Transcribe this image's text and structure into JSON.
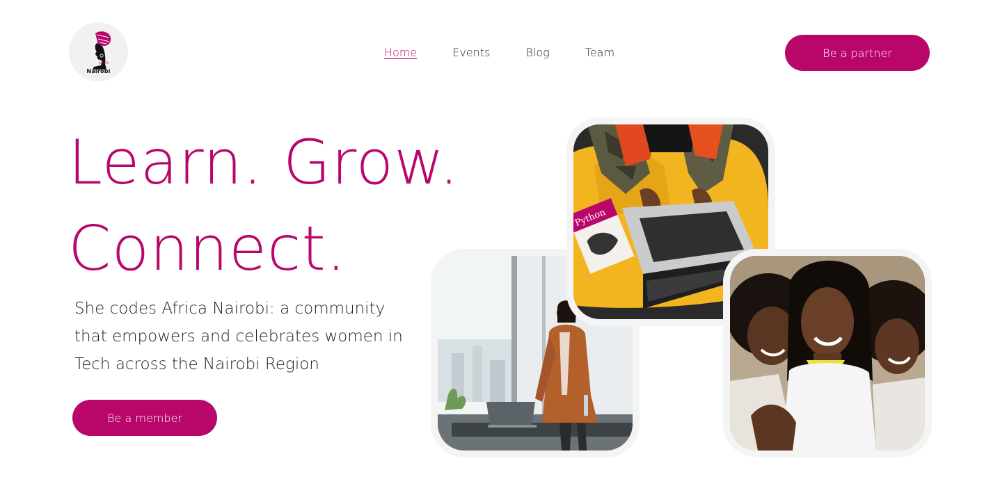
{
  "logo": {
    "text": "Nairobi",
    "icon": "she-codes-africa-logo"
  },
  "nav": {
    "items": [
      {
        "label": "Home",
        "active": true
      },
      {
        "label": "Events",
        "active": false
      },
      {
        "label": "Blog",
        "active": false
      },
      {
        "label": "Team",
        "active": false
      }
    ]
  },
  "header": {
    "partner_label": "Be a partner"
  },
  "hero": {
    "headline_line1": "Learn. Grow.",
    "headline_line2": "Connect.",
    "description": "She codes Africa Nairobi: a community that empowers and celebrates women in Tech across the Nairobi Region",
    "member_label": "Be a member"
  },
  "images": {
    "office": {
      "icon": "woman-on-phone-at-office-photo"
    },
    "laptop": {
      "icon": "woman-coding-on-laptop-photo",
      "book_label": "Python"
    },
    "friends": {
      "icon": "three-smiling-women-photo"
    }
  },
  "colors": {
    "accent": "#b8066a",
    "card_bg": "#f4f4f4"
  }
}
